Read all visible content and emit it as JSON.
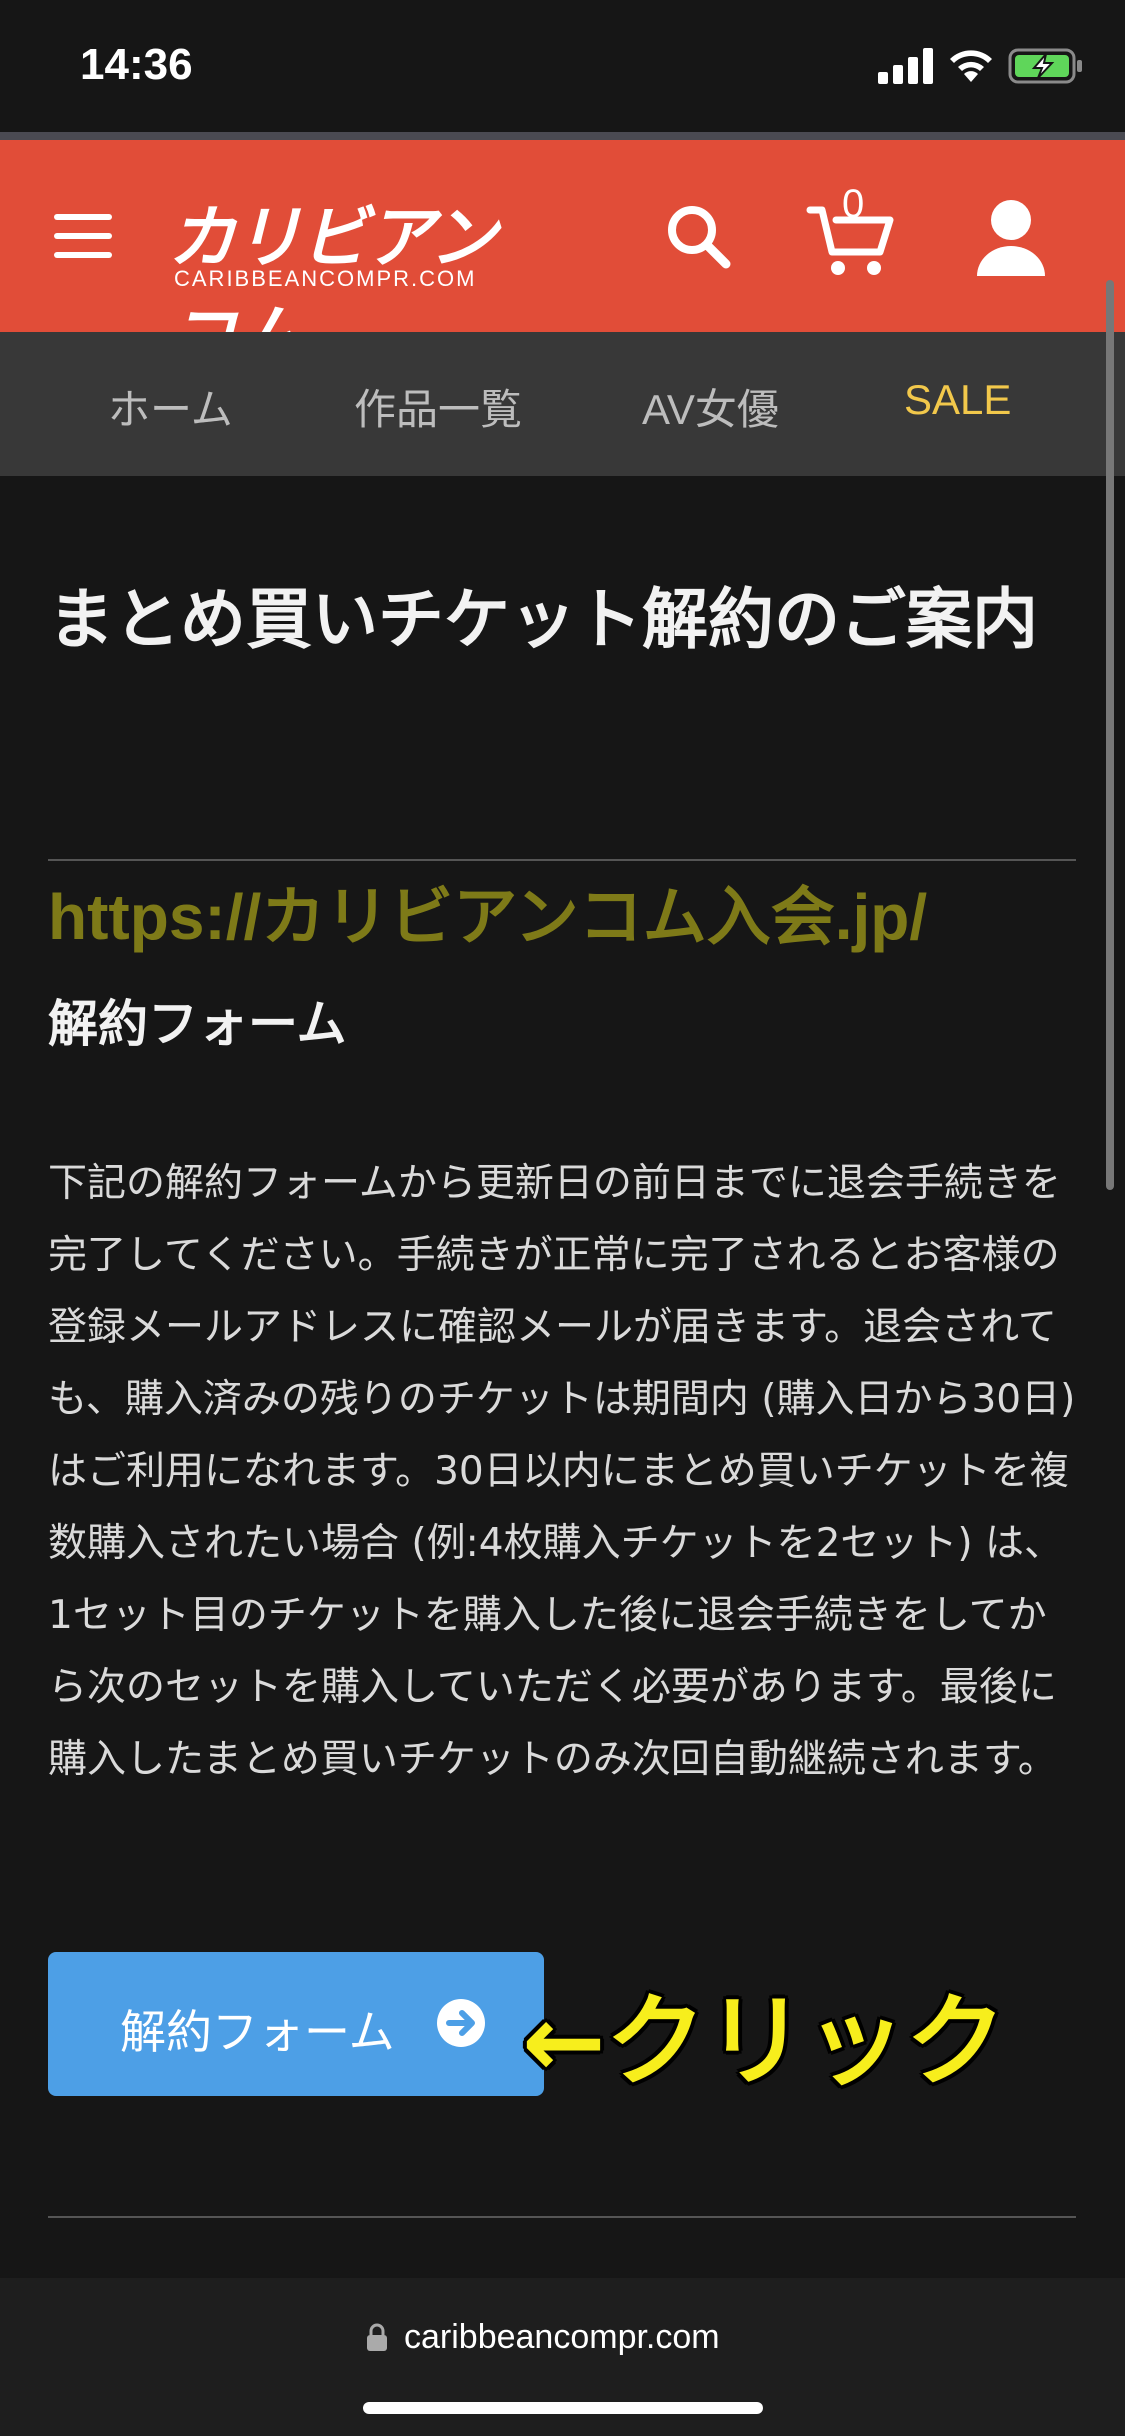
{
  "status_bar": {
    "time": "14:36"
  },
  "header": {
    "logo_jp": "カリビアンコム",
    "logo_en": "CARIBBEANCOMPR.COM",
    "cart_count": "0"
  },
  "nav": {
    "items": [
      {
        "label": "ホーム"
      },
      {
        "label": "作品一覧"
      },
      {
        "label": "AV女優"
      },
      {
        "label": "SALE"
      }
    ]
  },
  "main": {
    "title": "まとめ買いチケット解約のご案内",
    "watermark_url": "https://カリビアンコム入会.jp/",
    "section_title": "解約フォーム",
    "paragraph": "下記の解約フォームから更新日の前日までに退会手続きを完了してください。手続きが正常に完了されるとお客様の登録メールアドレスに確認メールが届きます。退会されても、購入済みの残りのチケットは期間内 (購入日から30日) はご利用になれます。30日以内にまとめ買いチケットを複数購入されたい場合 (例:4枚購入チケットを2セット) は、1セット目のチケットを購入した後に退会手続きをしてから次のセットを購入していただく必要があります。最後に購入したまとめ買いチケットのみ次回自動継続されます。",
    "button_label": "解約フォーム",
    "annotation": "←クリック"
  },
  "browser": {
    "domain": "caribbeancompr.com"
  },
  "colors": {
    "header_bg": "#e14d38",
    "nav_bg": "#383838",
    "sale": "#f2c84b",
    "button": "#4d9fe6",
    "annotation": "#f7ee1c"
  }
}
